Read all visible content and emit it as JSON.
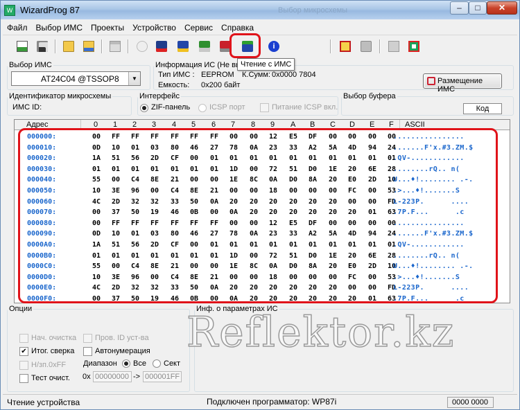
{
  "window": {
    "title": "WizardProg 87",
    "ghost_title": "Выбор микросхемы",
    "min": "–",
    "max": "□",
    "close": "✕"
  },
  "menu": [
    "Файл",
    "Выбор ИМС",
    "Проекты",
    "Устройство",
    "Сервис",
    "Справка"
  ],
  "toolbar": {
    "tooltip": "Чтение с ИМС"
  },
  "chip": {
    "legend": "Выбор ИМС",
    "selected": "AT24C04 @TSSOP8"
  },
  "info": {
    "legend": "Информация ИС (Не выбра",
    "type_label": "Тип ИМС :",
    "type_value": "EEPROM",
    "checksum_label": "К.Сумм:",
    "checksum_value": "0x0000 7804",
    "capacity_label": "Емкость:",
    "capacity_value": "0x200 байт"
  },
  "placement_button": "Размещение ИМС",
  "chip_id": {
    "legend": "Идентификатор микросхемы",
    "label": "ИМС ID:"
  },
  "interface": {
    "legend": "Интерфейс",
    "zif": "ZIF-панель",
    "icsp": "ICSP порт",
    "power": "Питание ICSP вкл."
  },
  "buffer": {
    "legend": "Выбор буфера",
    "value": "Код"
  },
  "grid": {
    "address_header": "Адрес",
    "col_headers": [
      "0",
      "1",
      "2",
      "3",
      "4",
      "5",
      "6",
      "7",
      "8",
      "9",
      "A",
      "B",
      "C",
      "D",
      "E",
      "F"
    ],
    "ascii_header": "ASCII",
    "rows": [
      {
        "addr": "000000:",
        "hex": [
          "00",
          "FF",
          "FF",
          "FF",
          "FF",
          "FF",
          "FF",
          "00",
          "00",
          "12",
          "E5",
          "DF",
          "00",
          "00",
          "00",
          "00"
        ],
        "ascii": "................"
      },
      {
        "addr": "000010:",
        "hex": [
          "0D",
          "10",
          "01",
          "03",
          "80",
          "46",
          "27",
          "78",
          "0A",
          "23",
          "33",
          "A2",
          "5A",
          "4D",
          "94",
          "24"
        ],
        "ascii": ".......F'x.#3.ZM.$"
      },
      {
        "addr": "000020:",
        "hex": [
          "1A",
          "51",
          "56",
          "2D",
          "CF",
          "00",
          "01",
          "01",
          "01",
          "01",
          "01",
          "01",
          "01",
          "01",
          "01",
          "01"
        ],
        "ascii": ".QV-............"
      },
      {
        "addr": "000030:",
        "hex": [
          "01",
          "01",
          "01",
          "01",
          "01",
          "01",
          "01",
          "1D",
          "00",
          "72",
          "51",
          "D0",
          "1E",
          "20",
          "6E",
          "28"
        ],
        "ascii": "........rQ.. n("
      },
      {
        "addr": "000040:",
        "hex": [
          "55",
          "00",
          "C4",
          "8E",
          "21",
          "00",
          "00",
          "1E",
          "8C",
          "0A",
          "D0",
          "8A",
          "20",
          "E0",
          "2D",
          "10"
        ],
        "ascii": "U...♦!........ .-."
      },
      {
        "addr": "000050:",
        "hex": [
          "10",
          "3E",
          "96",
          "00",
          "C4",
          "8E",
          "21",
          "00",
          "00",
          "18",
          "00",
          "00",
          "00",
          "FC",
          "00",
          "53"
        ],
        "ascii": ".>...♦!.......S"
      },
      {
        "addr": "000060:",
        "hex": [
          "4C",
          "2D",
          "32",
          "32",
          "33",
          "50",
          "0A",
          "20",
          "20",
          "20",
          "20",
          "20",
          "20",
          "00",
          "00",
          "FD"
        ],
        "ascii": "L-223P.      ...."
      },
      {
        "addr": "000070:",
        "hex": [
          "00",
          "37",
          "50",
          "19",
          "46",
          "0B",
          "00",
          "0A",
          "20",
          "20",
          "20",
          "20",
          "20",
          "20",
          "01",
          "63"
        ],
        "ascii": ".7P.F...      .c"
      },
      {
        "addr": "000080:",
        "hex": [
          "00",
          "FF",
          "FF",
          "FF",
          "FF",
          "FF",
          "FF",
          "00",
          "00",
          "12",
          "E5",
          "DF",
          "00",
          "00",
          "00",
          "00"
        ],
        "ascii": "................"
      },
      {
        "addr": "000090:",
        "hex": [
          "0D",
          "10",
          "01",
          "03",
          "80",
          "46",
          "27",
          "78",
          "0A",
          "23",
          "33",
          "A2",
          "5A",
          "4D",
          "94",
          "24"
        ],
        "ascii": ".......F'x.#3.ZM.$"
      },
      {
        "addr": "0000A0:",
        "hex": [
          "1A",
          "51",
          "56",
          "2D",
          "CF",
          "00",
          "01",
          "01",
          "01",
          "01",
          "01",
          "01",
          "01",
          "01",
          "01",
          "01"
        ],
        "ascii": ".QV-............"
      },
      {
        "addr": "0000B0:",
        "hex": [
          "01",
          "01",
          "01",
          "01",
          "01",
          "01",
          "01",
          "1D",
          "00",
          "72",
          "51",
          "D0",
          "1E",
          "20",
          "6E",
          "28"
        ],
        "ascii": "........rQ.. n("
      },
      {
        "addr": "0000C0:",
        "hex": [
          "55",
          "00",
          "C4",
          "8E",
          "21",
          "00",
          "00",
          "1E",
          "8C",
          "0A",
          "D0",
          "8A",
          "20",
          "E0",
          "2D",
          "10"
        ],
        "ascii": "U...♦!........ .-."
      },
      {
        "addr": "0000D0:",
        "hex": [
          "10",
          "3E",
          "96",
          "00",
          "C4",
          "8E",
          "21",
          "00",
          "00",
          "18",
          "00",
          "00",
          "00",
          "FC",
          "00",
          "53"
        ],
        "ascii": ".>...♦!.......S"
      },
      {
        "addr": "0000E0:",
        "hex": [
          "4C",
          "2D",
          "32",
          "32",
          "33",
          "50",
          "0A",
          "20",
          "20",
          "20",
          "20",
          "20",
          "20",
          "00",
          "00",
          "FD"
        ],
        "ascii": "L-223P.      ...."
      },
      {
        "addr": "0000F0:",
        "hex": [
          "00",
          "37",
          "50",
          "19",
          "46",
          "0B",
          "00",
          "0A",
          "20",
          "20",
          "20",
          "20",
          "20",
          "20",
          "01",
          "63"
        ],
        "ascii": ".7P.F...      .c"
      }
    ]
  },
  "options": {
    "legend": "Опции",
    "clear": "Нач. очистка",
    "check_id": "Пров. ID уст-ва",
    "verify": "Итог. сверка",
    "autonum": "Автонумерация",
    "empty": "Н/зп.0xFF",
    "range_label": "Диапазон",
    "all": "Все",
    "sect": "Сект",
    "test": "Тест очист.",
    "hex_prefix": "0x",
    "from": "00000000",
    "arrow": "->",
    "to": "000001FF"
  },
  "params": {
    "legend": "Инф. о параметрах ИС"
  },
  "watermark": "Reflektor.kz",
  "status": {
    "left": "Чтение устройства",
    "center": "Подключен программатор: WP87i",
    "right": "0000 0000"
  },
  "colors": {
    "highlight": "#e0131a",
    "address": "#1a66cc",
    "ascii": "#1a66cc"
  }
}
